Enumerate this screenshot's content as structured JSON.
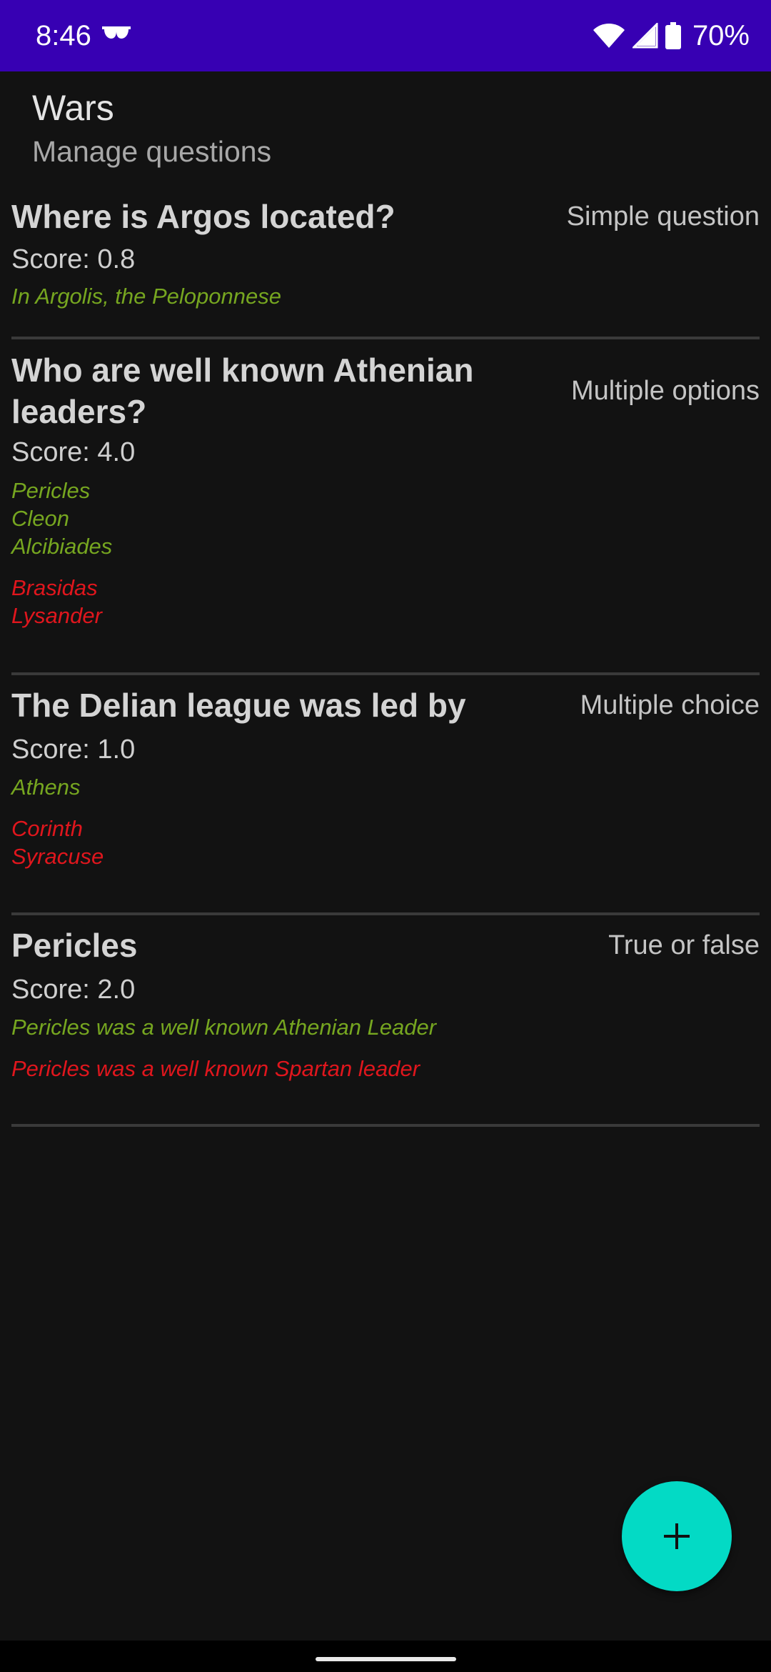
{
  "status_bar": {
    "time": "8:46",
    "battery_percent": "70%",
    "icons": [
      "glasses-icon",
      "wifi-icon",
      "signal-icon",
      "battery-icon"
    ]
  },
  "header": {
    "title": "Wars",
    "subtitle": "Manage questions"
  },
  "questions": [
    {
      "title": "Where is Argos located?",
      "type": "Simple question",
      "score": "Score: 0.8",
      "correct": [
        "In Argolis, the Peloponnese"
      ],
      "wrong": []
    },
    {
      "title": "Who are well known Athenian leaders?",
      "type": "Multiple options",
      "score": "Score: 4.0",
      "correct": [
        "Pericles",
        "Cleon",
        "Alcibiades"
      ],
      "wrong": [
        "Brasidas",
        "Lysander"
      ]
    },
    {
      "title": "The Delian league was led by",
      "type": "Multiple choice",
      "score": "Score: 1.0",
      "correct": [
        "Athens"
      ],
      "wrong": [
        "Corinth",
        "Syracuse"
      ]
    },
    {
      "title": "Pericles",
      "type": "True or false",
      "score": "Score: 2.0",
      "correct": [
        "Pericles was a well known Athenian Leader"
      ],
      "wrong": [
        "Pericles was a well known Spartan leader"
      ]
    }
  ],
  "fab": {
    "icon": "add-icon"
  },
  "colors": {
    "status_bar": "#3700b3",
    "background": "#121212",
    "correct_answer": "#76a620",
    "wrong_answer": "#e0161d",
    "fab": "#03dac5"
  }
}
